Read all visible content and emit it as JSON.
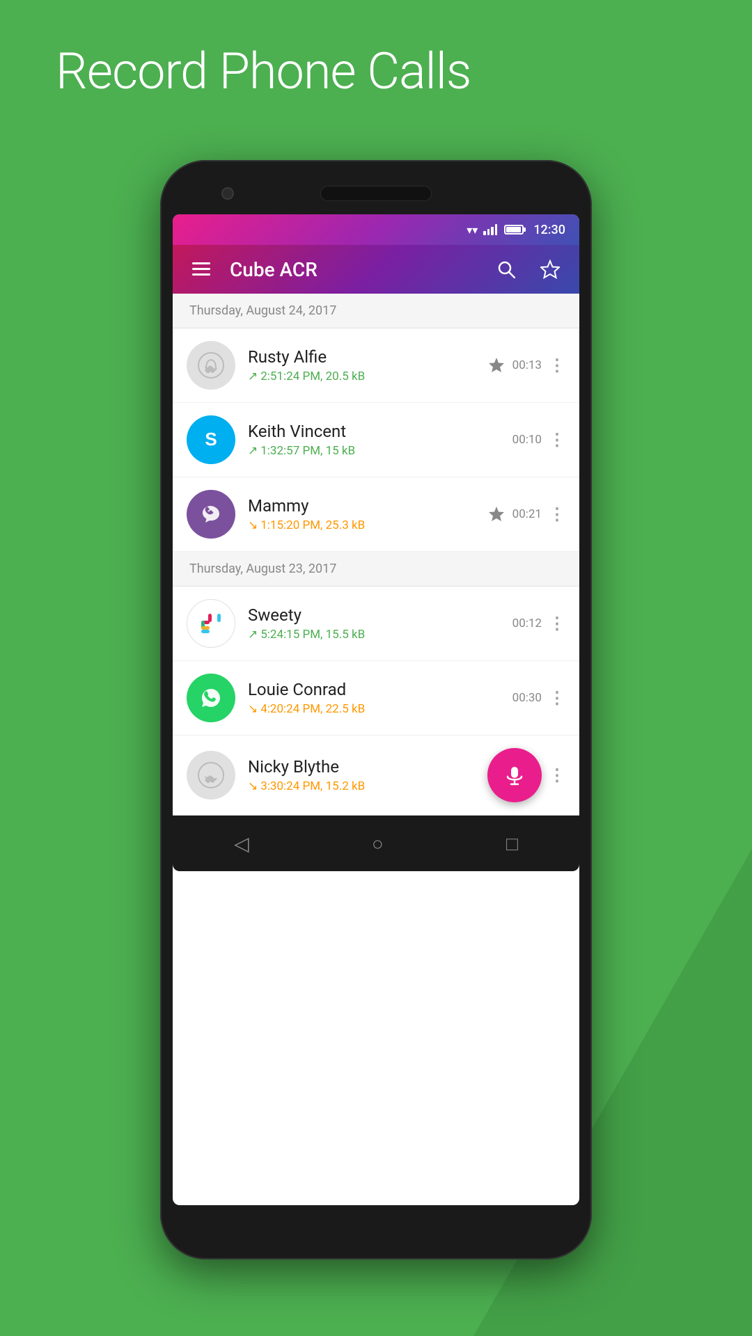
{
  "page": {
    "headline": "Record Phone Calls",
    "background_color": "#4caf50"
  },
  "status_bar": {
    "time": "12:30"
  },
  "app_bar": {
    "title": "Cube ACR",
    "menu_label": "☰",
    "search_label": "🔍",
    "star_label": "☆"
  },
  "sections": [
    {
      "date": "Thursday, August 24, 2017",
      "calls": [
        {
          "name": "Rusty Alfie",
          "meta": "2:51:24 PM, 20.5 kB",
          "direction": "outgoing",
          "duration": "00:13",
          "starred": true,
          "avatar_type": "phone"
        },
        {
          "name": "Keith Vincent",
          "meta": "1:32:57 PM, 15 kB",
          "direction": "outgoing",
          "duration": "00:10",
          "starred": false,
          "avatar_type": "skype"
        },
        {
          "name": "Mammy",
          "meta": "1:15:20 PM, 25.3 kB",
          "direction": "incoming",
          "duration": "00:21",
          "starred": true,
          "avatar_type": "viber"
        }
      ]
    },
    {
      "date": "Thursday, August 23, 2017",
      "calls": [
        {
          "name": "Sweety",
          "meta": "5:24:15 PM, 15.5 kB",
          "direction": "outgoing",
          "duration": "00:12",
          "starred": false,
          "avatar_type": "slack"
        },
        {
          "name": "Louie Conrad",
          "meta": "4:20:24 PM, 22.5 kB",
          "direction": "incoming",
          "duration": "00:30",
          "starred": false,
          "avatar_type": "whatsapp"
        },
        {
          "name": "Nicky Blythe",
          "meta": "3:30:24 PM, 15.2 kB",
          "direction": "incoming",
          "duration": "",
          "starred": false,
          "avatar_type": "phone",
          "has_fab": true
        }
      ]
    }
  ],
  "nav": {
    "back": "◁",
    "home": "○",
    "recents": "□"
  }
}
